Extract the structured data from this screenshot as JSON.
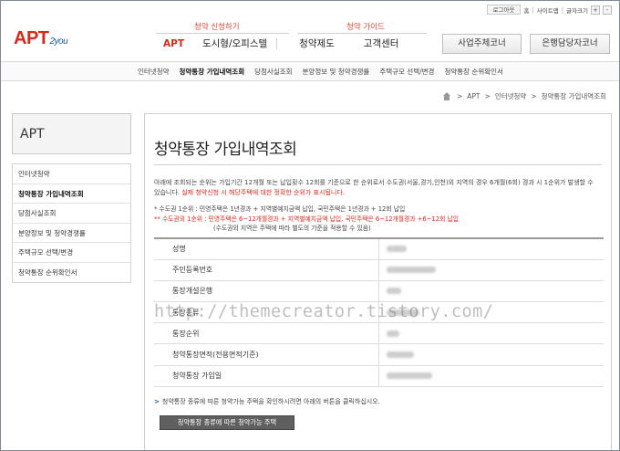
{
  "util": {
    "logout": "로그아웃",
    "home": "홈",
    "sitemap": "사이트맵",
    "fontsize": "글자크기",
    "plus": "+",
    "minus": "-"
  },
  "brand": {
    "logo": "APT",
    "logo_sub": "2you"
  },
  "guides": {
    "apply": "청약 신청하기",
    "guide": "청약 가이드"
  },
  "nav": {
    "apt": "APT",
    "urban": "도시형/오피스텔",
    "system": "청약제도",
    "service": "고객센터"
  },
  "header_buttons": {
    "business": "사업주체코너",
    "bank": "은행담당자코너"
  },
  "subnav": [
    "인터넷청약",
    "청약통장 가입내역조회",
    "당첨사실조회",
    "분양정보 및 청약경쟁률",
    "주택규모 선택/변경",
    "청약통장 순위확인서"
  ],
  "breadcrumb": [
    "APT",
    "인터넷청약",
    "청약통장 가입내역조회"
  ],
  "sidebar": {
    "title": "APT",
    "items": [
      "인터넷청약",
      "청약통장 가입내역조회",
      "당첨사실조회",
      "분양정보 및 청약경쟁률",
      "주택규모 선택/변경",
      "청약통장 순위확인서"
    ]
  },
  "page": {
    "title": "청약통장 가입내역조회",
    "desc_main": "아래에 조회되는 순위는 가입기간 12개월 또는 납입횟수 12회를 기준으로 한 순위로서 수도권(서울,경기,인천)외 지역의 경우 6개월(6회) 경과 시 1순위가 발생할 수 있습니다. ",
    "desc_red": "실제 청약신청 시 해당주택에 대한 정확한 순위가 표시됩니다.",
    "note1": "* 수도권   1순위 : 민영주택은 1년경과 + 지역별예치금액 납입, 국민주택은 1년경과 + 12회 납입",
    "note2": "** 수도권외 1순위 : 민영주택은 6~12개월경과 + 지역별예치금액 납입, 국민주택은 6~12개월경과 +6~12회 납입",
    "note3": "(수도권외 지역은 주택에 따라 별도의 기준을 적용할 수 있음)",
    "rows": [
      "성명",
      "주민등록번호",
      "통장개설은행",
      "통장종류",
      "통장순위",
      "청약통장면적(전용면적기준)",
      "청약통장 가입일"
    ],
    "hint": "청약통장 종류에 따른 청약가능 주택을 확인하시려면 아래의 버튼을 클릭하십시오.",
    "button": "청약통장 종류에 따른 청약가능 주택"
  },
  "watermark": "http://themecreator.tistory.com/"
}
